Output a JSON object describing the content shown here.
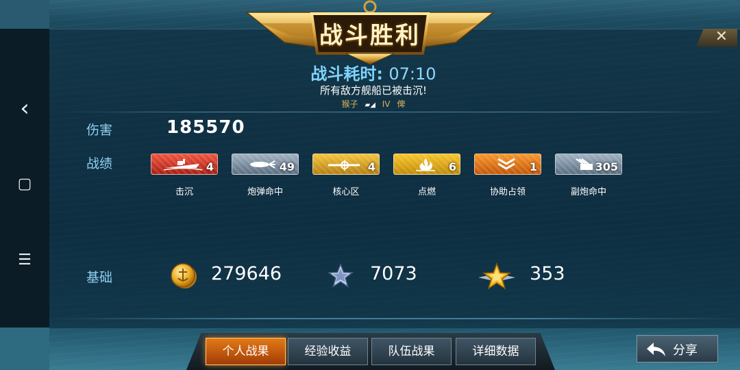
{
  "title": "战斗胜利",
  "battle_time": {
    "label": "战斗耗时:",
    "value": "07:10"
  },
  "battle_message": "所有敌方舰船已被击沉!",
  "mvp": {
    "player": "猴子",
    "rank": "IV",
    "title": "俾"
  },
  "damage": {
    "label": "伤害",
    "value": "185570"
  },
  "record": {
    "label": "战绩",
    "items": [
      {
        "name": "击沉",
        "count": "4",
        "color": "#d93a2a",
        "icon": "ship-sink-icon"
      },
      {
        "name": "炮弹命中",
        "count": "49",
        "color": "#7f93a6",
        "icon": "shell-hit-icon"
      },
      {
        "name": "核心区",
        "count": "4",
        "color": "#d9a21a",
        "icon": "citadel-icon"
      },
      {
        "name": "点燃",
        "count": "6",
        "color": "#e2a414",
        "icon": "fire-icon"
      },
      {
        "name": "协助占领",
        "count": "1",
        "color": "#e2741a",
        "icon": "capture-assist-icon"
      },
      {
        "name": "副炮命中",
        "count": "305",
        "color": "#7f93a6",
        "icon": "secondary-gun-icon"
      }
    ]
  },
  "base": {
    "label": "基础",
    "coins": "279646",
    "experience": "7073",
    "commander_exp": "353"
  },
  "tabs": [
    {
      "label": "个人战果",
      "active": true
    },
    {
      "label": "经验收益",
      "active": false
    },
    {
      "label": "队伍战果",
      "active": false
    },
    {
      "label": "详细数据",
      "active": false
    }
  ],
  "share_label": "分享",
  "close_symbol": "✕",
  "nav": {
    "back": "‹",
    "home": "▢",
    "menu": "☰"
  }
}
